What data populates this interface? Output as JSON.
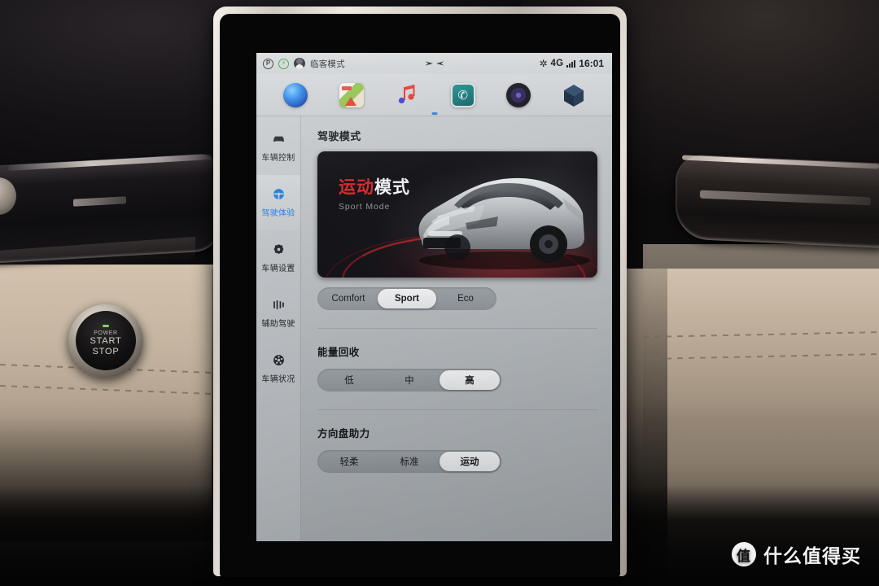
{
  "statusbar": {
    "park_icon": "parking-p-icon",
    "charge_icon": "charging-bolt-icon",
    "avatar_icon": "user-avatar-icon",
    "mode_label": "临客模式",
    "brand_logo": "xpeng-x-logo",
    "bluetooth_icon": "bluetooth-icon",
    "network_label": "4G",
    "signal_icon": "signal-bars-icon",
    "time": "16:01"
  },
  "dock": {
    "items": [
      {
        "name": "voice-assistant",
        "icon": "blue-sphere-icon"
      },
      {
        "name": "maps",
        "icon": "map-navigation-icon"
      },
      {
        "name": "music",
        "icon": "music-note-icon",
        "glyph": "♫"
      },
      {
        "name": "phone",
        "icon": "phone-handset-icon",
        "glyph": "✆"
      },
      {
        "name": "camera",
        "icon": "camera-lens-icon"
      },
      {
        "name": "apps",
        "icon": "cube-icon"
      }
    ]
  },
  "sidebar": {
    "items": [
      {
        "label": "车辆控制",
        "icon": "car-front-icon",
        "active": false
      },
      {
        "label": "驾驶体验",
        "icon": "steering-wheel-icon",
        "active": true
      },
      {
        "label": "车辆设置",
        "icon": "gear-icon",
        "active": false
      },
      {
        "label": "辅助驾驶",
        "icon": "parking-sensor-icon",
        "active": false
      },
      {
        "label": "车辆状况",
        "icon": "wheel-icon",
        "active": false
      }
    ]
  },
  "main": {
    "drive_mode": {
      "title": "驾驶模式",
      "hero": {
        "title_red": "运动",
        "title_white": "模式",
        "subtitle": "Sport Mode",
        "accent_color": "#d3262b"
      },
      "options": [
        "Comfort",
        "Sport",
        "Eco"
      ],
      "selected": "Sport"
    },
    "energy_recovery": {
      "title": "能量回收",
      "options": [
        "低",
        "中",
        "高"
      ],
      "selected": "高"
    },
    "steering_assist": {
      "title": "方向盘助力",
      "options": [
        "轻柔",
        "标准",
        "运动"
      ],
      "selected": "运动"
    }
  },
  "vehicle": {
    "start_button": {
      "line1": "POWER",
      "line2": "START",
      "line3": "STOP"
    }
  },
  "watermark": {
    "badge": "值",
    "text": "什么值得买"
  }
}
